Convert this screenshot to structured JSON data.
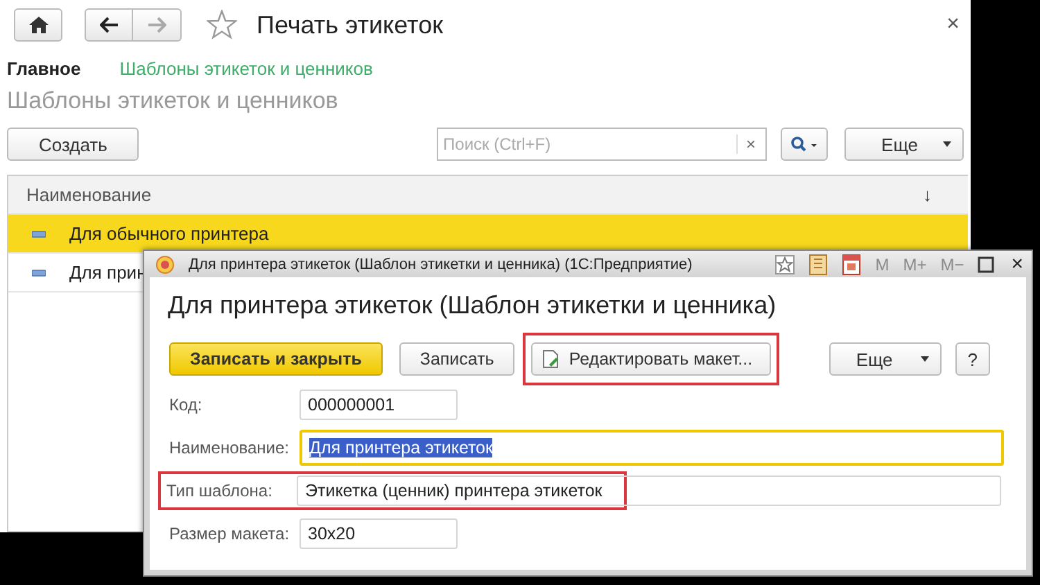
{
  "nav": {
    "title": "Печать этикеток",
    "close": "×"
  },
  "breadcrumbs": [
    {
      "label": "Главное",
      "selected": true
    },
    {
      "label": "Шаблоны этикеток и ценников",
      "selected": false
    }
  ],
  "subtitle": "Шаблоны этикеток и ценников",
  "toolbar": {
    "create": "Создать",
    "search_placeholder": "Поиск (Ctrl+F)",
    "clear": "×",
    "more": "Еще"
  },
  "table": {
    "columns": [
      "Наименование"
    ],
    "sort": "↓",
    "rows": [
      {
        "name": "Для обычного принтера",
        "selected": true
      },
      {
        "name": "Для прин",
        "selected": false
      }
    ]
  },
  "dialog": {
    "title": "Для принтера этикеток (Шаблон этикетки и ценника)  (1С:Предприятие)",
    "memory_buttons": [
      {
        "label": "M",
        "disabled": true
      },
      {
        "label": "M+",
        "disabled": true
      },
      {
        "label": "M−",
        "disabled": true
      }
    ],
    "close": "×",
    "heading": "Для принтера этикеток (Шаблон этикетки и ценника)",
    "buttons": [
      {
        "label": "Записать и закрыть",
        "kind": "primary",
        "highlighted": false
      },
      {
        "label": "Записать",
        "kind": "normal",
        "highlighted": false
      },
      {
        "label": "Редактировать макет...",
        "kind": "edit",
        "highlighted": true
      }
    ],
    "more": "Еще",
    "help": "?",
    "fields": [
      {
        "label": "Код:",
        "value": "000000001",
        "kind": "short",
        "focused": false,
        "highlighted": false
      },
      {
        "label": "Наименование:",
        "value": "Для принтера этикеток",
        "kind": "wide",
        "focused": true,
        "highlighted": false
      },
      {
        "label": "Тип шаблона:",
        "value": "Этикетка (ценник) принтера этикеток",
        "kind": "wide",
        "focused": false,
        "highlighted": true
      },
      {
        "label": "Размер макета:",
        "value": "30x20",
        "kind": "short",
        "focused": false,
        "highlighted": false
      }
    ]
  }
}
